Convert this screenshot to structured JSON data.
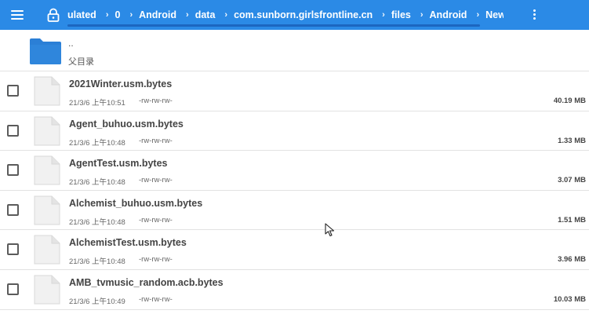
{
  "appbar": {
    "background": "#2b8ae6",
    "menu_icon": "hamburger-icon",
    "lock_icon": "lock-icon",
    "more_icon": "more-vertical-icon",
    "breadcrumbs": [
      "ulated",
      "0",
      "Android",
      "data",
      "com.sunborn.girlsfrontline.cn",
      "files",
      "Android",
      "New"
    ],
    "separator": "›"
  },
  "parent": {
    "dots": "..",
    "label": "父目录",
    "icon": "folder-icon",
    "icon_color": "#2b7fd6"
  },
  "files": [
    {
      "name": "2021Winter.usm.bytes",
      "date": "21/3/6 上午10:51",
      "perm": "-rw-rw-rw-",
      "size": "40.19 MB"
    },
    {
      "name": "Agent_buhuo.usm.bytes",
      "date": "21/3/6 上午10:48",
      "perm": "-rw-rw-rw-",
      "size": "1.33 MB"
    },
    {
      "name": "AgentTest.usm.bytes",
      "date": "21/3/6 上午10:48",
      "perm": "-rw-rw-rw-",
      "size": "3.07 MB"
    },
    {
      "name": "Alchemist_buhuo.usm.bytes",
      "date": "21/3/6 上午10:48",
      "perm": "-rw-rw-rw-",
      "size": "1.51 MB"
    },
    {
      "name": "AlchemistTest.usm.bytes",
      "date": "21/3/6 上午10:48",
      "perm": "-rw-rw-rw-",
      "size": "3.96 MB"
    },
    {
      "name": "AMB_tvmusic_random.acb.bytes",
      "date": "21/3/6 上午10:49",
      "perm": "-rw-rw-rw-",
      "size": "10.03 MB"
    }
  ]
}
